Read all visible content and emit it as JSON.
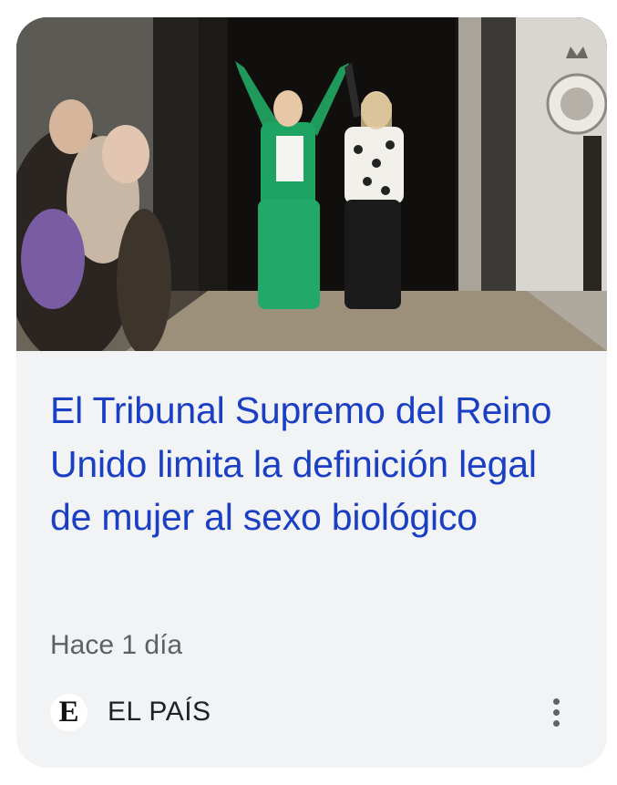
{
  "card": {
    "headline": "El Tribunal Supremo del Reino Unido limita la definición legal de mujer al sexo biológico",
    "time_ago": "Hace 1 día",
    "source": {
      "name": "EL PAÍS",
      "logo_letter": "E"
    },
    "more_icon": "more-vert-icon"
  },
  "colors": {
    "headline": "#1a3fc4",
    "card_background": "#f2f3f5",
    "meta_text": "#5e6064"
  }
}
